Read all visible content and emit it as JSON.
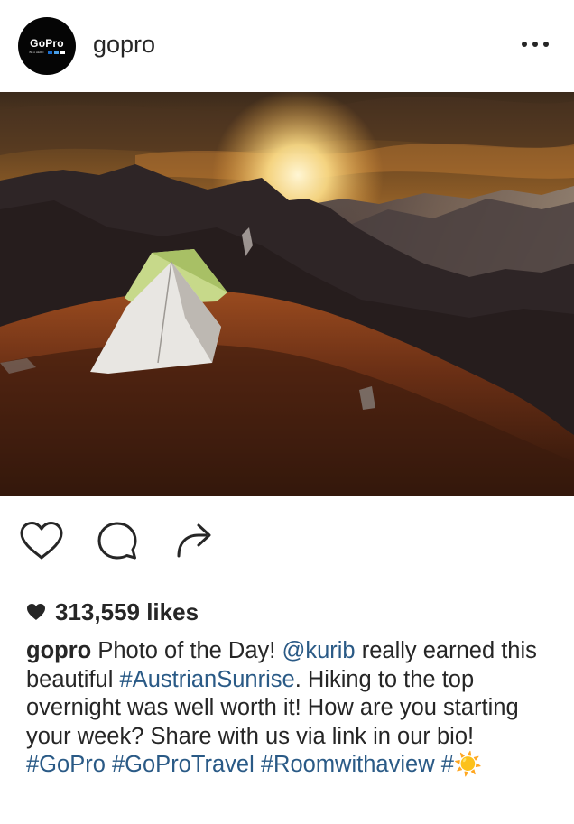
{
  "post": {
    "username": "gopro",
    "avatar": {
      "logo_text": "GoPro",
      "logo_subtext": "BE A HERO",
      "logo_colors": [
        "#1b6fd1",
        "#4aa0e8",
        "#ffffff"
      ]
    },
    "more_icon": "more-horizontal-icon",
    "image_alt_description_icon": "photo",
    "likes": "313,559 likes",
    "caption": {
      "username": "gopro",
      "text_1": " Photo of the Day! ",
      "mention": "@kurib",
      "text_2": " really earned this beautiful ",
      "hashtag_1": "#AustrianSunrise",
      "text_3": ". Hiking to the top overnight was well worth it! How are you starting your week? Share with us via link in our bio! ",
      "hashtag_2": "#GoPro",
      "text_4": " ",
      "hashtag_3": "#GoProTravel",
      "text_5": " ",
      "hashtag_4": "#Roomwithaview",
      "text_6": " ",
      "hashtag_5": "#",
      "emoji": "☀️"
    }
  },
  "icons": {
    "like": "heart-outline-icon",
    "comment": "comment-bubble-icon",
    "share": "share-arrow-icon",
    "likes_heart": "heart-filled-icon"
  },
  "colors": {
    "text": "#262626",
    "link": "#2a5a86",
    "divider": "#e6e6e6"
  }
}
